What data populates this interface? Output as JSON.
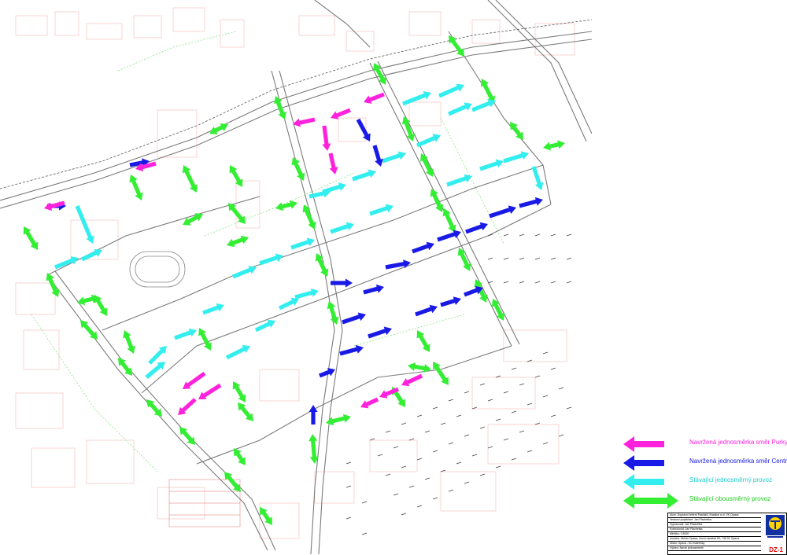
{
  "legend": {
    "items": [
      {
        "label": "Navržená jednosměrka směr Purkyňova",
        "color": "#ff22dd",
        "kind": "one-way"
      },
      {
        "label": "Navržená jednosměrka směr Centrum",
        "color": "#1a1ae6",
        "kind": "one-way"
      },
      {
        "label": "Stávající jednosměrný provoz",
        "color": "#33eeee",
        "kind": "one-way"
      },
      {
        "label": "Stávající obousměrný provoz",
        "color": "#33ee33",
        "kind": "two-way"
      }
    ]
  },
  "title_block": {
    "rows": [
      "Akce: Dopravní řešení Pasťáků, Kraslice a ul. VK Opava",
      "Vedoucí projektant: Jan Plachetka",
      "Vypracoval: Jan Plachetka",
      "Kontroloval: Jan Plachetka",
      "Měřítko: 1:5000",
      "Investor: Město Opava, Horní náměstí 69, 746 01 Opava",
      "Místo: Opava - KÚ Kateřinky",
      "Výkres: Návrh jednosměrek"
    ],
    "drawing_code": "DZ-1"
  },
  "colors": {
    "purkynova": "#ff22dd",
    "centrum": "#1a1ae6",
    "existing_oneway": "#33eeee",
    "existing_twoway": "#33ee33"
  }
}
